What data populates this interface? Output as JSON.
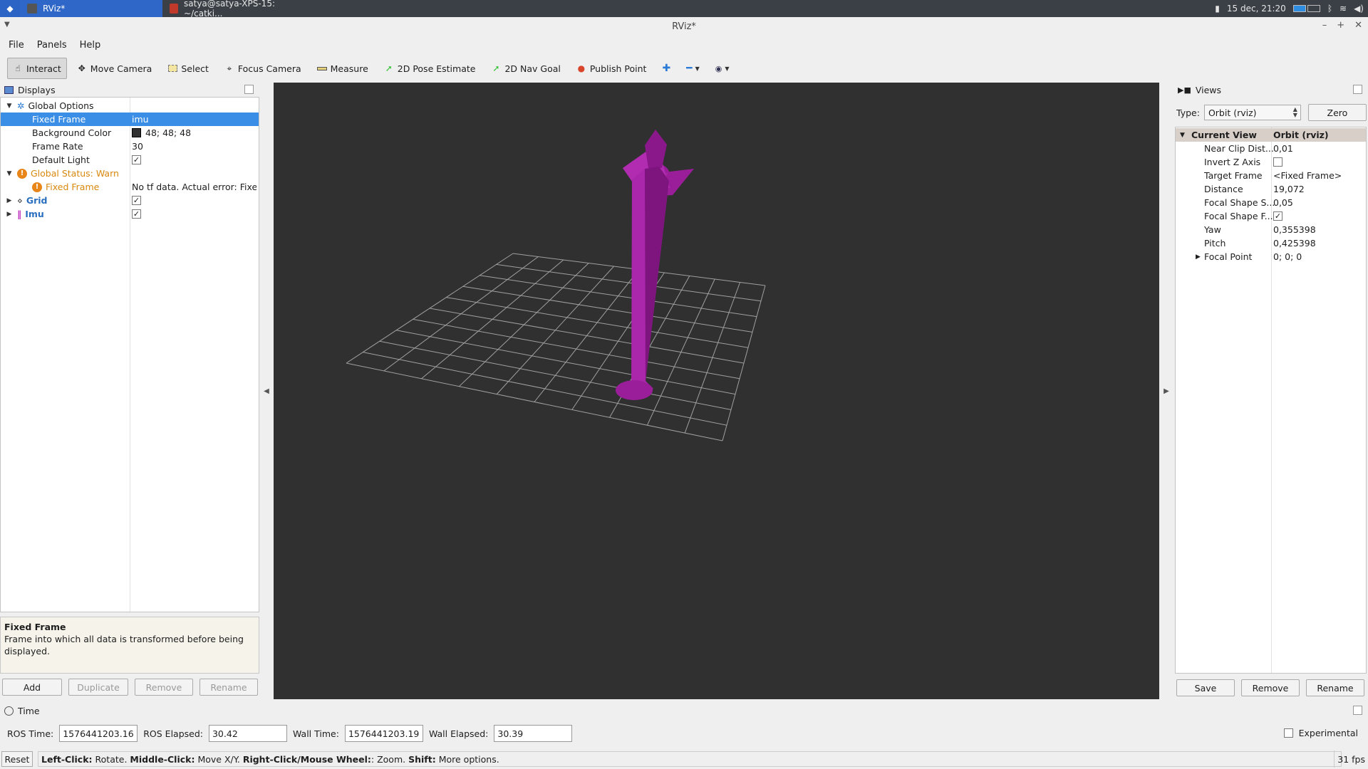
{
  "taskbar": {
    "tasks": [
      {
        "label": "RViz*",
        "active": true
      },
      {
        "label": "satya@satya-XPS-15: ~/catki...",
        "active": false
      }
    ],
    "clock": "15 dec, 21:20"
  },
  "window": {
    "title": "RViz*"
  },
  "menu": [
    "File",
    "Panels",
    "Help"
  ],
  "toolbar": {
    "tools": [
      {
        "label": "Interact",
        "icon": "hand-icon",
        "active": true
      },
      {
        "label": "Move Camera",
        "icon": "move-camera-icon",
        "active": false
      },
      {
        "label": "Select",
        "icon": "select-icon",
        "active": false
      },
      {
        "label": "Focus Camera",
        "icon": "focus-camera-icon",
        "active": false
      },
      {
        "label": "Measure",
        "icon": "measure-icon",
        "active": false
      },
      {
        "label": "2D Pose Estimate",
        "icon": "pose-estimate-icon",
        "active": false
      },
      {
        "label": "2D Nav Goal",
        "icon": "nav-goal-icon",
        "active": false
      },
      {
        "label": "Publish Point",
        "icon": "publish-point-icon",
        "active": false
      }
    ]
  },
  "displays": {
    "title": "Displays",
    "rows": {
      "global_options": "Global Options",
      "fixed_frame": {
        "name": "Fixed Frame",
        "value": "imu"
      },
      "background_color": {
        "name": "Background Color",
        "value": "48; 48; 48"
      },
      "frame_rate": {
        "name": "Frame Rate",
        "value": "30"
      },
      "default_light": {
        "name": "Default Light",
        "checked": true
      },
      "global_status": "Global Status: Warn",
      "status_fixed_frame": {
        "name": "Fixed Frame",
        "value": "No tf data.  Actual error: Fixe..."
      },
      "grid": {
        "name": "Grid",
        "checked": true
      },
      "imu": {
        "name": "Imu",
        "checked": true
      }
    },
    "description": {
      "title": "Fixed Frame",
      "text": "Frame into which all data is transformed before being displayed."
    },
    "buttons": {
      "add": "Add",
      "duplicate": "Duplicate",
      "remove": "Remove",
      "rename": "Rename"
    }
  },
  "views": {
    "title": "Views",
    "type_label": "Type:",
    "type_value": "Orbit (rviz)",
    "zero": "Zero",
    "current_view": {
      "name": "Current View",
      "value": "Orbit (rviz)"
    },
    "props": [
      {
        "name": "Near Clip Dist...",
        "value": "0,01"
      },
      {
        "name": "Invert Z Axis",
        "value": "",
        "checkbox": true,
        "checked": false
      },
      {
        "name": "Target Frame",
        "value": "<Fixed Frame>"
      },
      {
        "name": "Distance",
        "value": "19,072"
      },
      {
        "name": "Focal Shape S...",
        "value": "0,05"
      },
      {
        "name": "Focal Shape F...",
        "value": "",
        "checkbox": true,
        "checked": true
      },
      {
        "name": "Yaw",
        "value": "0,355398"
      },
      {
        "name": "Pitch",
        "value": "0,425398"
      },
      {
        "name": "Focal Point",
        "value": "0; 0; 0",
        "expandable": true
      }
    ],
    "buttons": {
      "save": "Save",
      "remove": "Remove",
      "rename": "Rename"
    }
  },
  "time": {
    "title": "Time",
    "ros_time_label": "ROS Time:",
    "ros_time": "1576441203.16",
    "ros_elapsed_label": "ROS Elapsed:",
    "ros_elapsed": "30.42",
    "wall_time_label": "Wall Time:",
    "wall_time": "1576441203.19",
    "wall_elapsed_label": "Wall Elapsed:",
    "wall_elapsed": "30.39",
    "experimental": "Experimental"
  },
  "status": {
    "reset": "Reset",
    "left_click": "Left-Click:",
    "left_click_text": "Rotate.",
    "middle_click": "Middle-Click:",
    "middle_click_text": "Move X/Y.",
    "right_click": "Right-Click/Mouse Wheel:",
    "right_click_text": ": Zoom.",
    "shift": "Shift:",
    "shift_text": "More options.",
    "fps": "31 fps"
  },
  "colors": {
    "viewport_bg": "#303030",
    "arrow": "#8e1a8e",
    "selection": "#3a8ee6",
    "warn": "#e8861a"
  }
}
